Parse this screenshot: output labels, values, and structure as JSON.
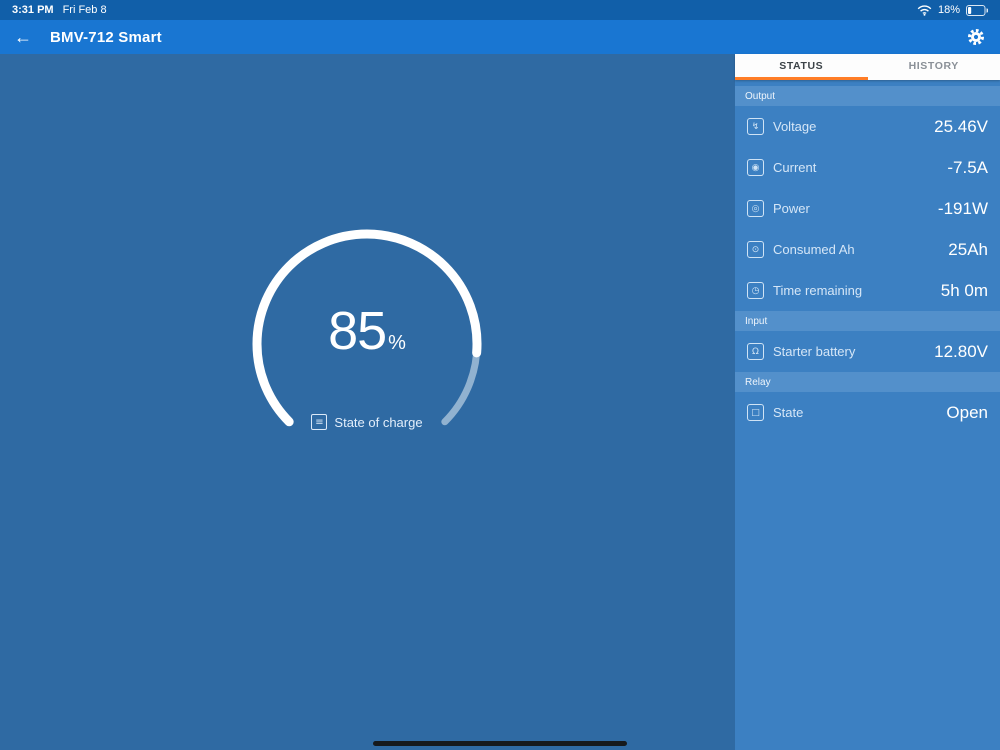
{
  "status_bar": {
    "time": "3:31 PM",
    "date": "Fri Feb 8",
    "battery_percent": "18%"
  },
  "header": {
    "title": "BMV-712 Smart"
  },
  "tabs": [
    {
      "label": "STATUS",
      "active": true
    },
    {
      "label": "HISTORY",
      "active": false
    }
  ],
  "gauge": {
    "percent": 85,
    "percent_text": "85",
    "unit": "%",
    "caption": "State of charge"
  },
  "panel": {
    "sections": [
      {
        "title": "Output",
        "rows": [
          {
            "id": "voltage",
            "icon": "voltage-icon",
            "glyph": "↯",
            "label": "Voltage",
            "value": "25.46V"
          },
          {
            "id": "current",
            "icon": "current-icon",
            "glyph": "◉",
            "label": "Current",
            "value": "-7.5A"
          },
          {
            "id": "power",
            "icon": "power-icon",
            "glyph": "◎",
            "label": "Power",
            "value": "-191W"
          },
          {
            "id": "consumed-ah",
            "icon": "consumed-ah-icon",
            "glyph": "⊙",
            "label": "Consumed Ah",
            "value": "25Ah"
          },
          {
            "id": "time-remaining",
            "icon": "time-remaining-icon",
            "glyph": "◷",
            "label": "Time remaining",
            "value": "5h 0m"
          }
        ]
      },
      {
        "title": "Input",
        "rows": [
          {
            "id": "starter-battery",
            "icon": "starter-battery-icon",
            "glyph": "Ω",
            "label": "Starter battery",
            "value": "12.80V"
          }
        ]
      },
      {
        "title": "Relay",
        "rows": [
          {
            "id": "relay-state",
            "icon": "relay-state-icon",
            "glyph": "□",
            "label": "State",
            "value": "Open"
          }
        ]
      }
    ]
  },
  "colors": {
    "accent_orange": "#ff7d27",
    "header_blue": "#1976d2",
    "status_bar_blue": "#115fa9",
    "main_blue": "#2f6aa3",
    "panel_blue": "#3c80c2",
    "section_band_blue": "#5390cb"
  }
}
